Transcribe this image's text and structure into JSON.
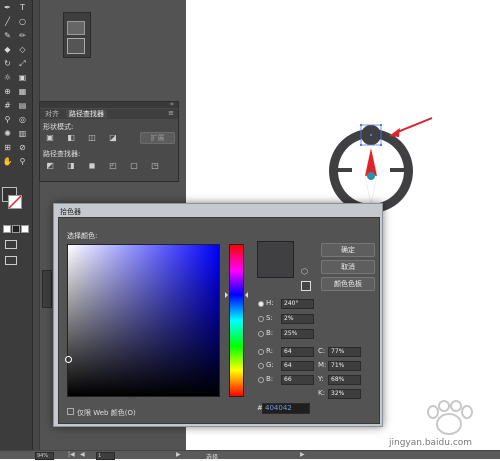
{
  "statusbar": {
    "zoom": "94%",
    "page": "1",
    "mode": "选择"
  },
  "pathfinder": {
    "tabs": [
      "对齐",
      "路径查找器"
    ],
    "shape_modes_label": "形状模式:",
    "expand_label": "扩展",
    "pathfinders_label": "路径查找器:"
  },
  "picker": {
    "title": "拾色器",
    "select_label": "选择颜色:",
    "ok_label": "确定",
    "cancel_label": "取消",
    "swatches_label": "颜色色板",
    "fields": {
      "H": {
        "label": "H:",
        "value": "240°"
      },
      "S": {
        "label": "S:",
        "value": "2%"
      },
      "Bv": {
        "label": "B:",
        "value": "25%"
      },
      "R": {
        "label": "R:",
        "value": "64"
      },
      "G": {
        "label": "G:",
        "value": "64"
      },
      "Bc": {
        "label": "B:",
        "value": "66"
      },
      "C": {
        "label": "C:",
        "value": "77%"
      },
      "M": {
        "label": "M:",
        "value": "71%"
      },
      "Y": {
        "label": "Y:",
        "value": "68%"
      },
      "K": {
        "label": "K:",
        "value": "32%"
      }
    },
    "hex_value": "404042",
    "web_only_label": "仅限 Web 颜色(O)",
    "current_color": "#404042"
  },
  "watermark": {
    "text": "jingyan.baidu.com"
  },
  "colors": {
    "arrow": "#e0232a",
    "compass_dark": "#404042",
    "selection": "#4f7ee8"
  }
}
